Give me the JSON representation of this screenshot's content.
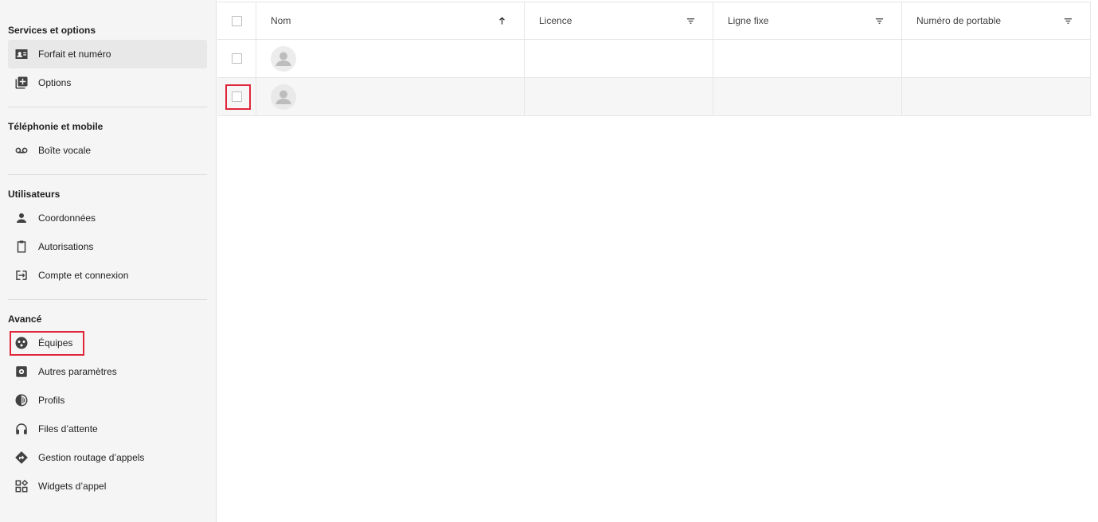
{
  "sidebar": {
    "sections": [
      {
        "title": "Services et options",
        "items": [
          {
            "label": "Forfait et numéro",
            "icon": "contact-card-icon"
          },
          {
            "label": "Options",
            "icon": "add-box-icon"
          }
        ]
      },
      {
        "title": "Téléphonie et mobile",
        "items": [
          {
            "label": "Boîte vocale",
            "icon": "voicemail-icon"
          }
        ]
      },
      {
        "title": "Utilisateurs",
        "items": [
          {
            "label": "Coordonnées",
            "icon": "person-icon"
          },
          {
            "label": "Autorisations",
            "icon": "clipboard-icon"
          },
          {
            "label": "Compte et connexion",
            "icon": "login-icon"
          }
        ]
      },
      {
        "title": "Avancé",
        "items": [
          {
            "label": "Équipes",
            "icon": "team-icon"
          },
          {
            "label": "Autres paramètres",
            "icon": "settings-box-icon"
          },
          {
            "label": "Profils",
            "icon": "contrast-icon"
          },
          {
            "label": "Files d’attente",
            "icon": "headset-icon"
          },
          {
            "label": "Gestion routage d’appels",
            "icon": "directions-icon"
          },
          {
            "label": "Widgets d’appel",
            "icon": "widgets-icon"
          }
        ]
      }
    ],
    "active_item": "Forfait et numéro"
  },
  "table": {
    "columns": [
      {
        "label": "Nom",
        "icon": "arrow-up-icon"
      },
      {
        "label": "Licence",
        "icon": "filter-icon"
      },
      {
        "label": "Ligne fixe",
        "icon": "filter-icon"
      },
      {
        "label": "Numéro de portable",
        "icon": "filter-icon"
      }
    ],
    "rows": [
      {
        "nom": "",
        "licence": "",
        "ligne_fixe": "",
        "portable": ""
      },
      {
        "nom": "",
        "licence": "",
        "ligne_fixe": "",
        "portable": ""
      }
    ]
  },
  "colors": {
    "sidebar_bg": "#f5f5f5",
    "active_bg": "#e8e8e8",
    "highlight": "#e0263b"
  }
}
